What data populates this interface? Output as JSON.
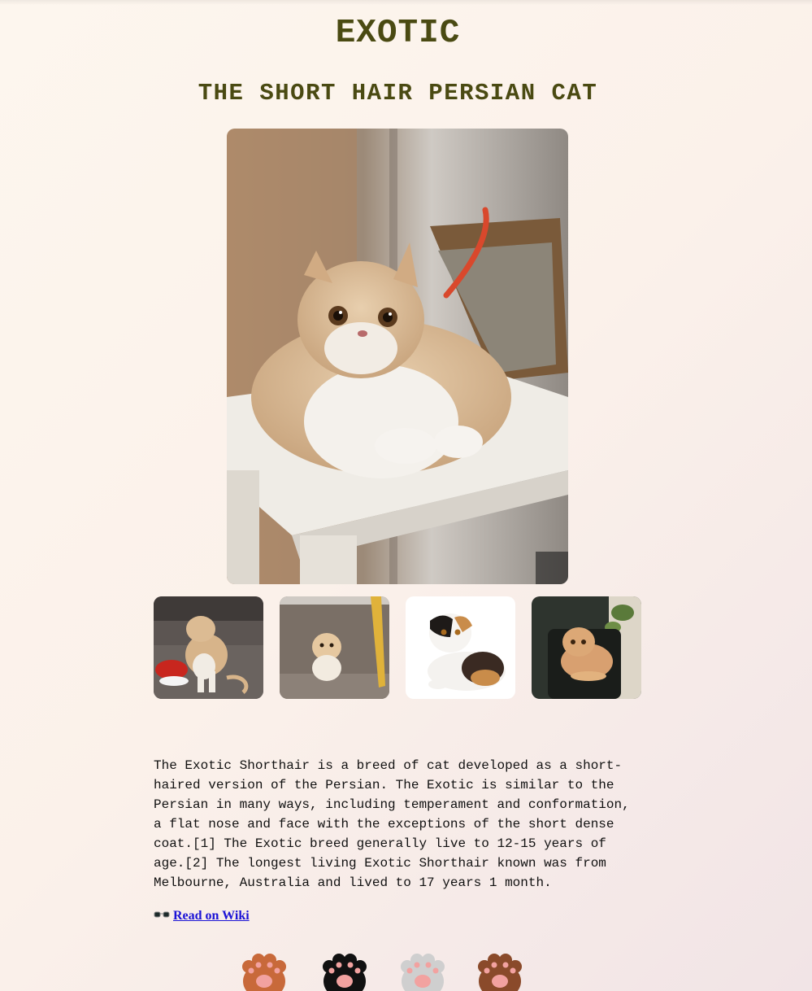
{
  "header": {
    "title": "EXOTIC",
    "subtitle": "THE SHORT HAIR PERSIAN CAT"
  },
  "gallery": {
    "hero_alt": "Exotic shorthair cat on white stool",
    "thumbnails": [
      {
        "alt": "Cat on sofa with red hat"
      },
      {
        "alt": "Kitten under table"
      },
      {
        "alt": "Calico exotic on white"
      },
      {
        "alt": "Orange exotic on black chair"
      }
    ]
  },
  "article": {
    "description": "The Exotic Shorthair is a breed of cat developed as a short-haired version of the Persian. The Exotic is similar to the Persian in many ways, including temperament and conformation, a flat nose and face with the exceptions of the short dense coat.[1] The Exotic breed generally live to 12-15 years of age.[2] The longest living Exotic Shorthair known was from Melbourne, Australia and lived to 17 years 1 month.",
    "wiki_link_label": "Read on Wiki",
    "wiki_icon": "glasses-icon"
  },
  "paws": {
    "colors": [
      "#c8693a",
      "#111111",
      "#cfcfcf",
      "#8a4a2a"
    ],
    "pad_color": "#f2a2a0"
  }
}
